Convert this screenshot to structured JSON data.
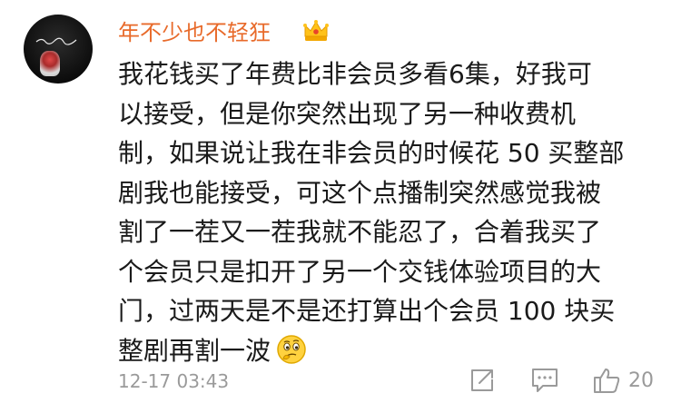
{
  "comment": {
    "username": "年不少也不轻狂",
    "lines": [
      "我花钱买了年费比非会员多看6集，好我可",
      "以接受，但是你突然出现了另一种收费机",
      "制，如果说让我在非会员的时候花 50 买整部",
      "剧我也能接受，可这个点播制突然感觉我被",
      "割了一茬又一茬我就不能忍了，合着我买了",
      "个会员只是扣开了另一个交钱体验项目的大",
      "门，过两天是不是还打算出个会员 100 块买",
      "整剧再割一波"
    ],
    "timestamp": "12-17 03:43",
    "like_count": "20"
  },
  "colors": {
    "username": "#e86a2a",
    "text": "#1a1a1a",
    "meta": "#9a9a9a"
  },
  "icons": {
    "badge": "crown-icon",
    "inline_emoji": "thinking-face-icon",
    "share": "share-icon",
    "comment": "comment-icon",
    "like": "thumbs-up-icon"
  }
}
